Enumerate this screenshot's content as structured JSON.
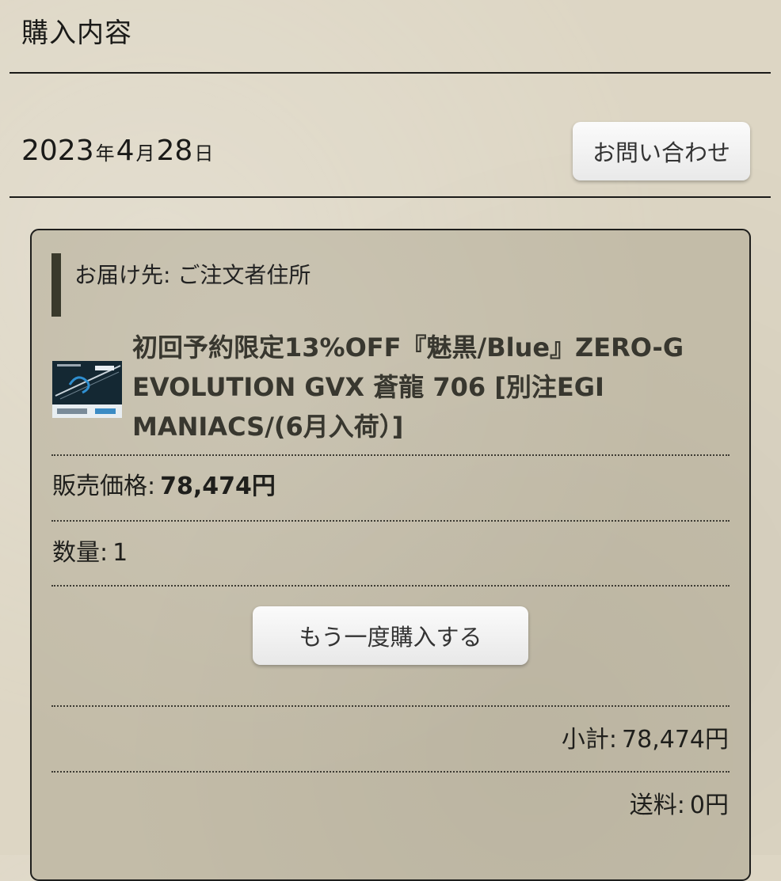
{
  "header": {
    "title": "購入内容"
  },
  "order": {
    "date_year": "2023",
    "date_year_unit": "年",
    "date_month": "4",
    "date_month_unit": "月",
    "date_day": "28",
    "date_day_unit": "日",
    "contact_button_label": "お問い合わせ"
  },
  "card": {
    "delivery_label": "お届け先: ご注文者住所",
    "product_name": "初回予約限定13%OFF『魅黒/Blue』ZERO-G EVOLUTION GVX 蒼龍 706 [別注EGI MANIACS/(6月入荷）]",
    "price_label": "販売価格:",
    "price_value": "78,474円",
    "quantity_label": "数量:",
    "quantity_value": "1",
    "rebuy_button_label": "もう一度購入する",
    "subtotal_label": "小計:",
    "subtotal_value": "78,474円",
    "shipping_label": "送料:",
    "shipping_value": "0円"
  },
  "colors": {
    "page_background": "#ddd6c4",
    "card_background": "#c3bca8",
    "heading_bar": "#3a3a2c",
    "product_text": "#38372f"
  }
}
